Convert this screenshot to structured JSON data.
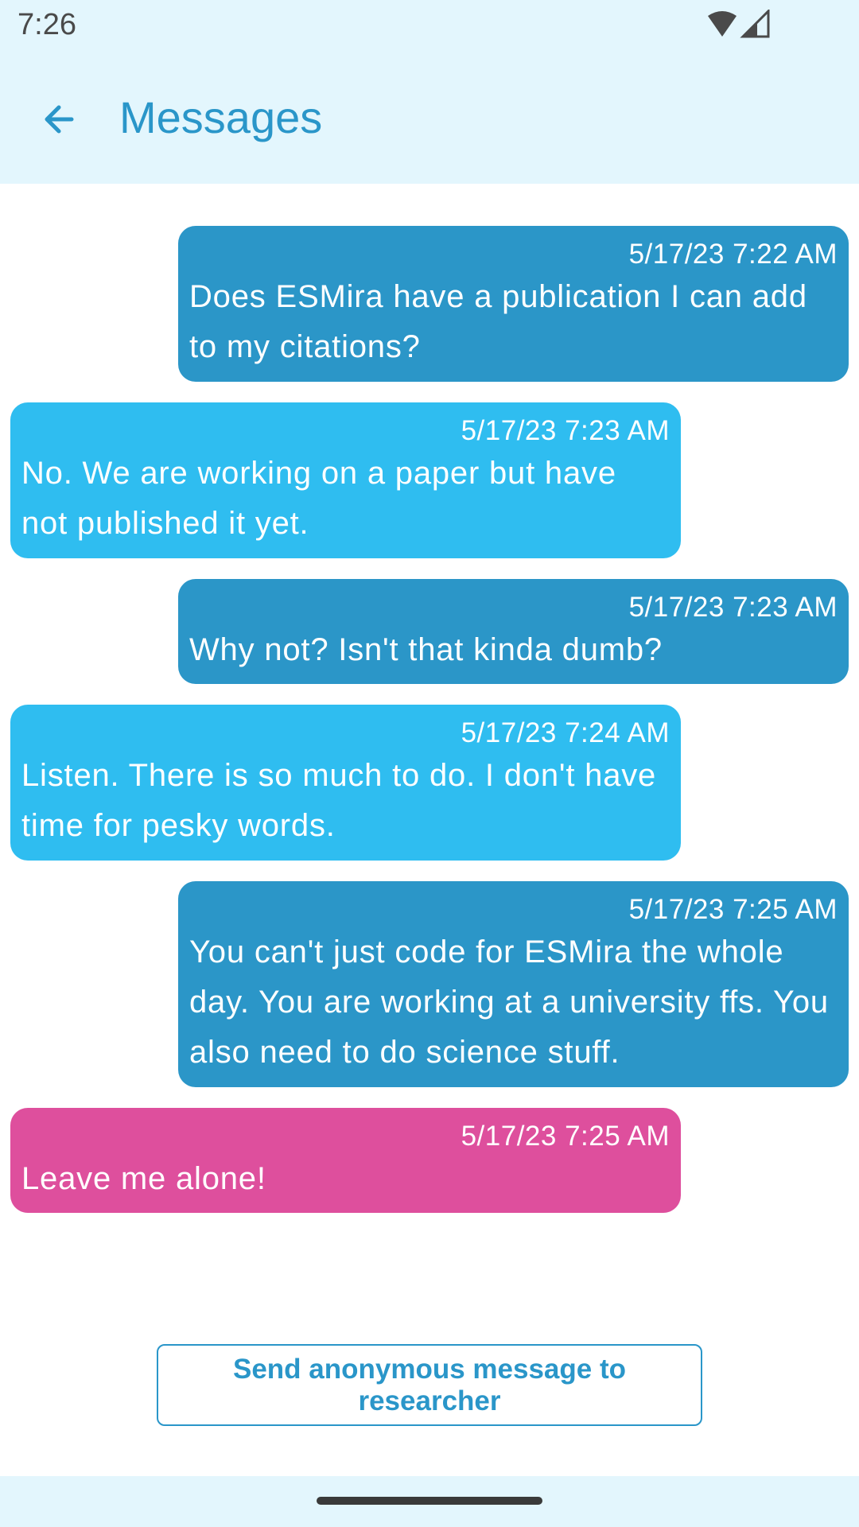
{
  "status_bar": {
    "time": "7:26",
    "icons": [
      "wifi-icon",
      "cell-signal-icon"
    ]
  },
  "app_bar": {
    "back_icon": "arrow-left-icon",
    "title": "Messages"
  },
  "colors": {
    "accent": "#2a96c9",
    "sent_bubble": "#2b96c8",
    "received_bubble": "#2fbdf0",
    "highlight_bubble": "#de4f9d",
    "bar_background": "#e3f6fd"
  },
  "messages": [
    {
      "direction": "sent",
      "timestamp": "5/17/23 7:22 AM",
      "text": "Does ESMira have a publication I can add to my citations?"
    },
    {
      "direction": "received",
      "timestamp": "5/17/23 7:23 AM",
      "text": "No. We are working on a paper but have not published it yet."
    },
    {
      "direction": "sent",
      "timestamp": "5/17/23 7:23 AM",
      "text": "Why not? Isn't that kinda dumb?"
    },
    {
      "direction": "received",
      "timestamp": "5/17/23 7:24 AM",
      "text": "Listen. There is so much to do. I don't have time for pesky words."
    },
    {
      "direction": "sent",
      "timestamp": "5/17/23 7:25 AM",
      "text": "You can't just code for ESMira the whole day. You are working at a university ffs. You also need to do science stuff."
    },
    {
      "direction": "received",
      "timestamp": "5/17/23 7:25 AM",
      "text": "Leave me alone!"
    }
  ],
  "actions": {
    "send_message_label": "Send anonymous message to researcher"
  }
}
